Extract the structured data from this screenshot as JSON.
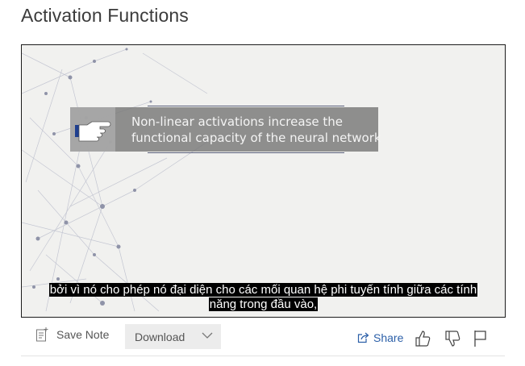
{
  "page": {
    "title": "Activation Functions"
  },
  "video": {
    "callout_line1": "Non-linear activations increase the",
    "callout_line2": "functional capacity of the neural network",
    "subtitle_line1": "bởi vì nó cho phép nó đại diện cho các mối quan hệ phi tuyến tính giữa các tính",
    "subtitle_line2": "năng trong đầu vào,"
  },
  "toolbar": {
    "save_note": "Save Note",
    "download": "Download",
    "share": "Share"
  },
  "icons": [
    "note-icon",
    "chevron-down-icon",
    "share-icon",
    "thumbs-up-icon",
    "thumbs-down-icon",
    "flag-icon",
    "pointing-hand-icon"
  ],
  "colors": {
    "share_link": "#2b5fa8",
    "callout_bg": "#7a7a7a",
    "subtitle_bg": "#000000"
  }
}
